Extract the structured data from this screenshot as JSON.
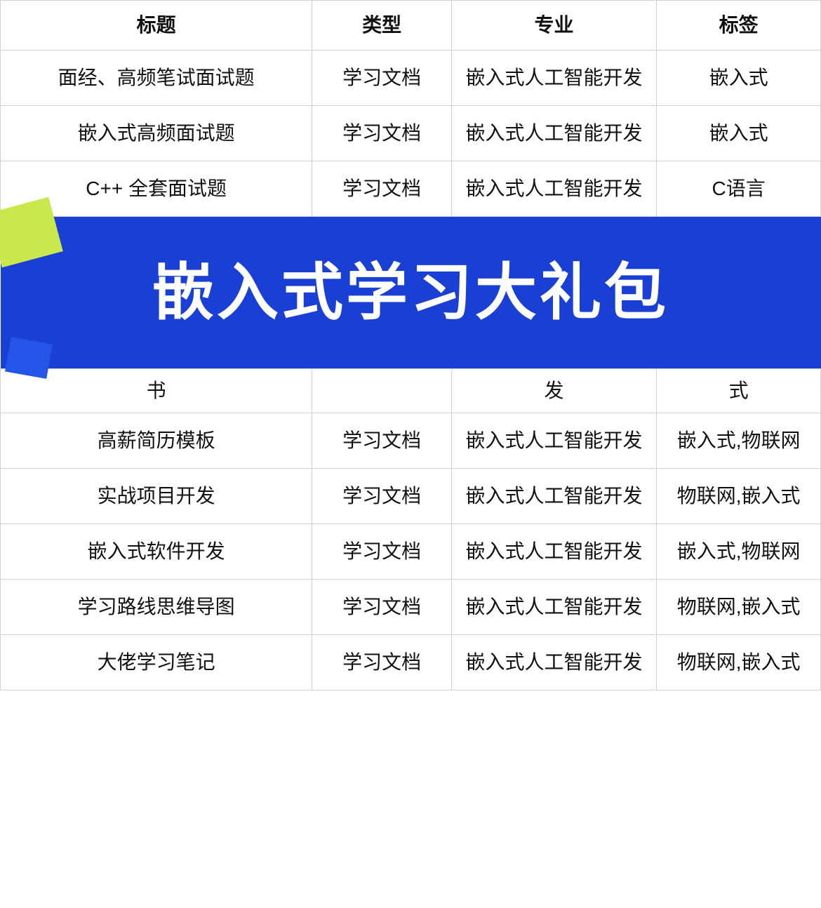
{
  "headers": {
    "col1": "标题",
    "col2": "类型",
    "col3": "专业",
    "col4": "标签"
  },
  "rows_top": [
    {
      "title": "面经、高频笔试面试题",
      "type": "学习文档",
      "major": "嵌入式人工智能开发",
      "tag": "嵌入式"
    },
    {
      "title": "嵌入式高频面试题",
      "type": "学习文档",
      "major": "嵌入式人工智能开发",
      "tag": "嵌入式"
    },
    {
      "title": "C++ 全套面试题",
      "type": "学习文档",
      "major": "嵌入式人工智能开发",
      "tag": "C语言"
    }
  ],
  "banner": {
    "text": "嵌入式学习大礼包"
  },
  "partial_row": {
    "col1": "书",
    "col2": "",
    "col3": "发",
    "col4": "式"
  },
  "rows_bottom": [
    {
      "title": "高薪简历模板",
      "type": "学习文档",
      "major": "嵌入式人工智能开发",
      "tag": "嵌入式,物联网"
    },
    {
      "title": "实战项目开发",
      "type": "学习文档",
      "major": "嵌入式人工智能开发",
      "tag": "物联网,嵌入式"
    },
    {
      "title": "嵌入式软件开发",
      "type": "学习文档",
      "major": "嵌入式人工智能开发",
      "tag": "嵌入式,物联网"
    },
    {
      "title": "学习路线思维导图",
      "type": "学习文档",
      "major": "嵌入式人工智能开发",
      "tag": "物联网,嵌入式"
    },
    {
      "title": "大佬学习笔记",
      "type": "学习文档",
      "major": "嵌入式人工智能开发",
      "tag": "物联网,嵌入式"
    }
  ]
}
